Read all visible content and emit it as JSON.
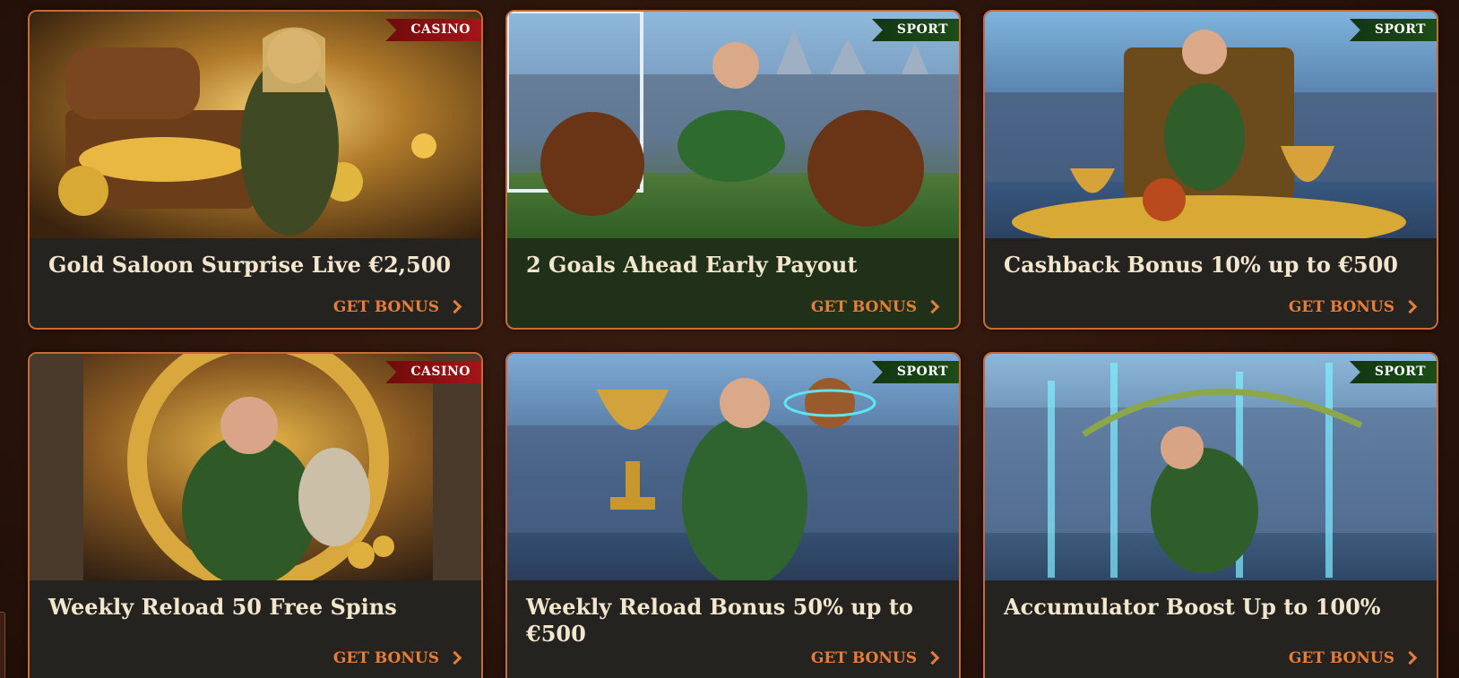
{
  "colors": {
    "background": "#2a140b",
    "card_border": "#c86a3a",
    "title_text": "#f3e6cf",
    "cta_text": "#e77d3b",
    "casino_tag": "#a6151a",
    "sport_tag": "#1d4d18"
  },
  "promotions": [
    {
      "tag": "CASINO",
      "title": "Gold Saloon Surprise Live €2,500",
      "cta": "GET BONUS"
    },
    {
      "tag": "SPORT",
      "title": "2 Goals Ahead Early Payout",
      "cta": "GET BONUS"
    },
    {
      "tag": "SPORT",
      "title": "Cashback Bonus 10% up to €500",
      "cta": "GET BONUS"
    },
    {
      "tag": "CASINO",
      "title": "Weekly Reload 50 Free Spins",
      "cta": "GET BONUS"
    },
    {
      "tag": "SPORT",
      "title": "Weekly Reload Bonus 50% up to €500",
      "cta": "GET BONUS"
    },
    {
      "tag": "SPORT",
      "title": "Accumulator Boost Up to 100%",
      "cta": "GET BONUS"
    }
  ],
  "icons": {
    "cta": "chevron-right-icon"
  }
}
